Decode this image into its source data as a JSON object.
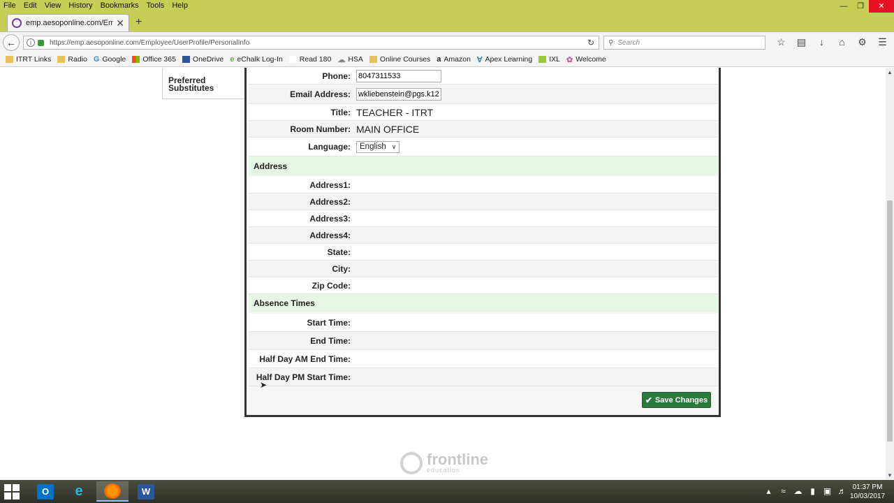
{
  "browser": {
    "menu": [
      "File",
      "Edit",
      "View",
      "History",
      "Bookmarks",
      "Tools",
      "Help"
    ],
    "tab_title": "emp.aesoponline.com/Empl",
    "url": "https://emp.aesoponline.com/Employee/UserProfile/PersonalInfo",
    "search_placeholder": "Search",
    "bookmarks": [
      "ITRT Links",
      "Radio",
      "Google",
      "Office 365",
      "OneDrive",
      "eChalk Log-In",
      "Read 180",
      "HSA",
      "Online Courses",
      "Amazon",
      "Apex Learning",
      "IXL",
      "Welcome"
    ]
  },
  "sidebar": {
    "item_label": "Preferred Substitutes"
  },
  "profile": {
    "phone_label": "Phone:",
    "phone_value": "8047311533",
    "email_label": "Email Address:",
    "email_value": "wkliebenstein@pgs.k12",
    "title_label": "Title:",
    "title_value": "TEACHER - ITRT",
    "room_label": "Room Number:",
    "room_value": "MAIN OFFICE",
    "language_label": "Language:",
    "language_value": "English"
  },
  "address": {
    "header": "Address",
    "address1_label": "Address1:",
    "address2_label": "Address2:",
    "address3_label": "Address3:",
    "address4_label": "Address4:",
    "state_label": "State:",
    "city_label": "City:",
    "zip_label": "Zip Code:"
  },
  "absence": {
    "header": "Absence Times",
    "start_label": "Start Time:",
    "end_label": "End Time:",
    "half_am_label": "Half Day AM End Time:",
    "half_pm_label": "Half Day PM Start Time:"
  },
  "save_label": "Save Changes",
  "footer": {
    "logo_name": "frontline",
    "logo_sub": "education"
  },
  "taskbar": {
    "time": "01:37 PM",
    "date": "10/03/2017"
  },
  "colors": {
    "firefox_chrome": "#c5cf55",
    "section_header": "#e7f5e7",
    "save_button": "#2a7a3b"
  }
}
